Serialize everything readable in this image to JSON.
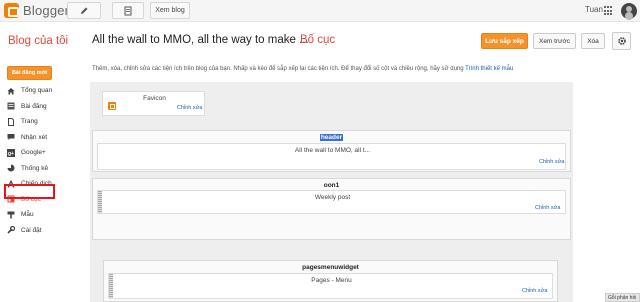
{
  "topbar": {
    "brand": "Blogger",
    "view_blog_label": "Xem blog",
    "user_name": "Tuan"
  },
  "header": {
    "blog_title": "Blog của tôi",
    "post_title": "All the wall to MMO, all the way to make ...",
    "separator": "·",
    "page_name": "Bố cục",
    "save_label": "Lưu sắp xếp",
    "preview_label": "Xem trước",
    "clear_label": "Xóa"
  },
  "sidebar": {
    "new_post_label": "Bài đăng mới",
    "items": [
      {
        "label": "Tổng quan",
        "icon": "home-icon"
      },
      {
        "label": "Bài đăng",
        "icon": "posts-icon"
      },
      {
        "label": "Trang",
        "icon": "pages-icon"
      },
      {
        "label": "Nhận xét",
        "icon": "comments-icon"
      },
      {
        "label": "Google+",
        "icon": "google-plus-icon"
      },
      {
        "label": "Thống kê",
        "icon": "stats-icon"
      },
      {
        "label": "Chiến dịch",
        "icon": "campaign-icon"
      },
      {
        "label": "Bố cục",
        "icon": "layout-icon",
        "active": true
      },
      {
        "label": "Mẫu",
        "icon": "template-icon"
      },
      {
        "label": "Cài đặt",
        "icon": "settings-icon"
      }
    ]
  },
  "main": {
    "intro_text": "Thêm, xóa, chỉnh sửa các tiện ích trên blog của bạn. Nhấp và kéo để sắp xếp lại các tiện ích. Để thay đổi số cột và chiều rộng, hãy sử dụng",
    "intro_link": "Trình thiết kế mẫu",
    "favicon": {
      "title": "Favicon",
      "edit": "Chỉnh sửa"
    },
    "header_section": {
      "title": "header",
      "widget_text": "All the wall to MMO, all t...",
      "edit": "Chỉnh sửa"
    },
    "section_1": {
      "title": "oon1",
      "widget_text": "Weekly post",
      "edit": "Chỉnh sửa"
    },
    "pages_section": {
      "title": "pagesmenuwidget",
      "widget_text": "Pages - Menu",
      "edit": "Chỉnh sửa"
    }
  },
  "tooltip": {
    "text": "Gỗi phản hồi"
  },
  "colors": {
    "accent_orange": "#f4932c",
    "title_red": "#dd4b39",
    "link_blue": "#1a5fb4",
    "active_outline": "#e8141b"
  }
}
